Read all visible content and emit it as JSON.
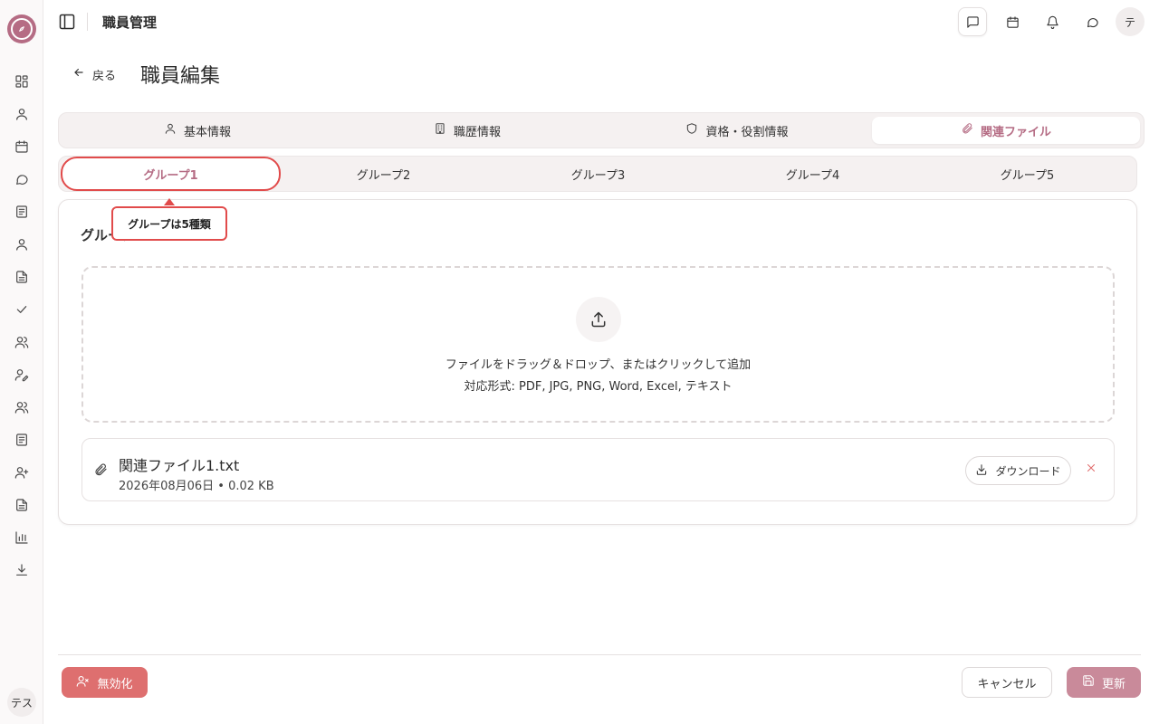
{
  "app": {
    "title": "職員管理",
    "user_initials_rail": "テス",
    "user_initials_header": "テ"
  },
  "colors": {
    "accent": "#b56c84",
    "danger": "#de6f6f",
    "highlight_outline": "#e14b4b",
    "update_button": "#c98a9a"
  },
  "rail": {
    "items": [
      {
        "icon": "dashboard-icon"
      },
      {
        "icon": "user-icon"
      },
      {
        "icon": "calendar-icon"
      },
      {
        "icon": "chat-icon"
      },
      {
        "icon": "document-icon"
      },
      {
        "icon": "user-icon"
      },
      {
        "icon": "file-text-icon"
      },
      {
        "icon": "check-icon"
      },
      {
        "icon": "users-icon"
      },
      {
        "icon": "user-edit-icon"
      },
      {
        "icon": "users-icon"
      },
      {
        "icon": "document-icon"
      },
      {
        "icon": "user-plus-icon"
      },
      {
        "icon": "file-text-icon"
      },
      {
        "icon": "bar-chart-icon"
      },
      {
        "icon": "download-icon"
      }
    ]
  },
  "header": {
    "icons": [
      "message-square-icon",
      "calendar-icon",
      "bell-icon",
      "message-circle-icon"
    ]
  },
  "page": {
    "back_label": "戻る",
    "title": "職員編集"
  },
  "tabs": [
    {
      "label": "基本情報",
      "icon": "user-icon",
      "active": false
    },
    {
      "label": "職歴情報",
      "icon": "building-icon",
      "active": false
    },
    {
      "label": "資格・役割情報",
      "icon": "shield-icon",
      "active": false
    },
    {
      "label": "関連ファイル",
      "icon": "paperclip-icon",
      "active": true
    }
  ],
  "groups": [
    {
      "label": "グループ1",
      "active": true
    },
    {
      "label": "グループ2",
      "active": false
    },
    {
      "label": "グループ3",
      "active": false
    },
    {
      "label": "グループ4",
      "active": false
    },
    {
      "label": "グループ5",
      "active": false
    }
  ],
  "annotation": {
    "tooltip": "グループは5種類"
  },
  "card": {
    "title": "グループ1",
    "dropzone": {
      "line1": "ファイルをドラッグ＆ドロップ、またはクリックして追加",
      "line2": "対応形式: PDF, JPG, PNG, Word, Excel, テキスト"
    },
    "files": [
      {
        "name": "関連ファイル1.txt",
        "meta": "2026年08月06日 • 0.02 KB",
        "download_label": "ダウンロード"
      }
    ]
  },
  "footer": {
    "disable_label": "無効化",
    "cancel_label": "キャンセル",
    "update_label": "更新"
  }
}
